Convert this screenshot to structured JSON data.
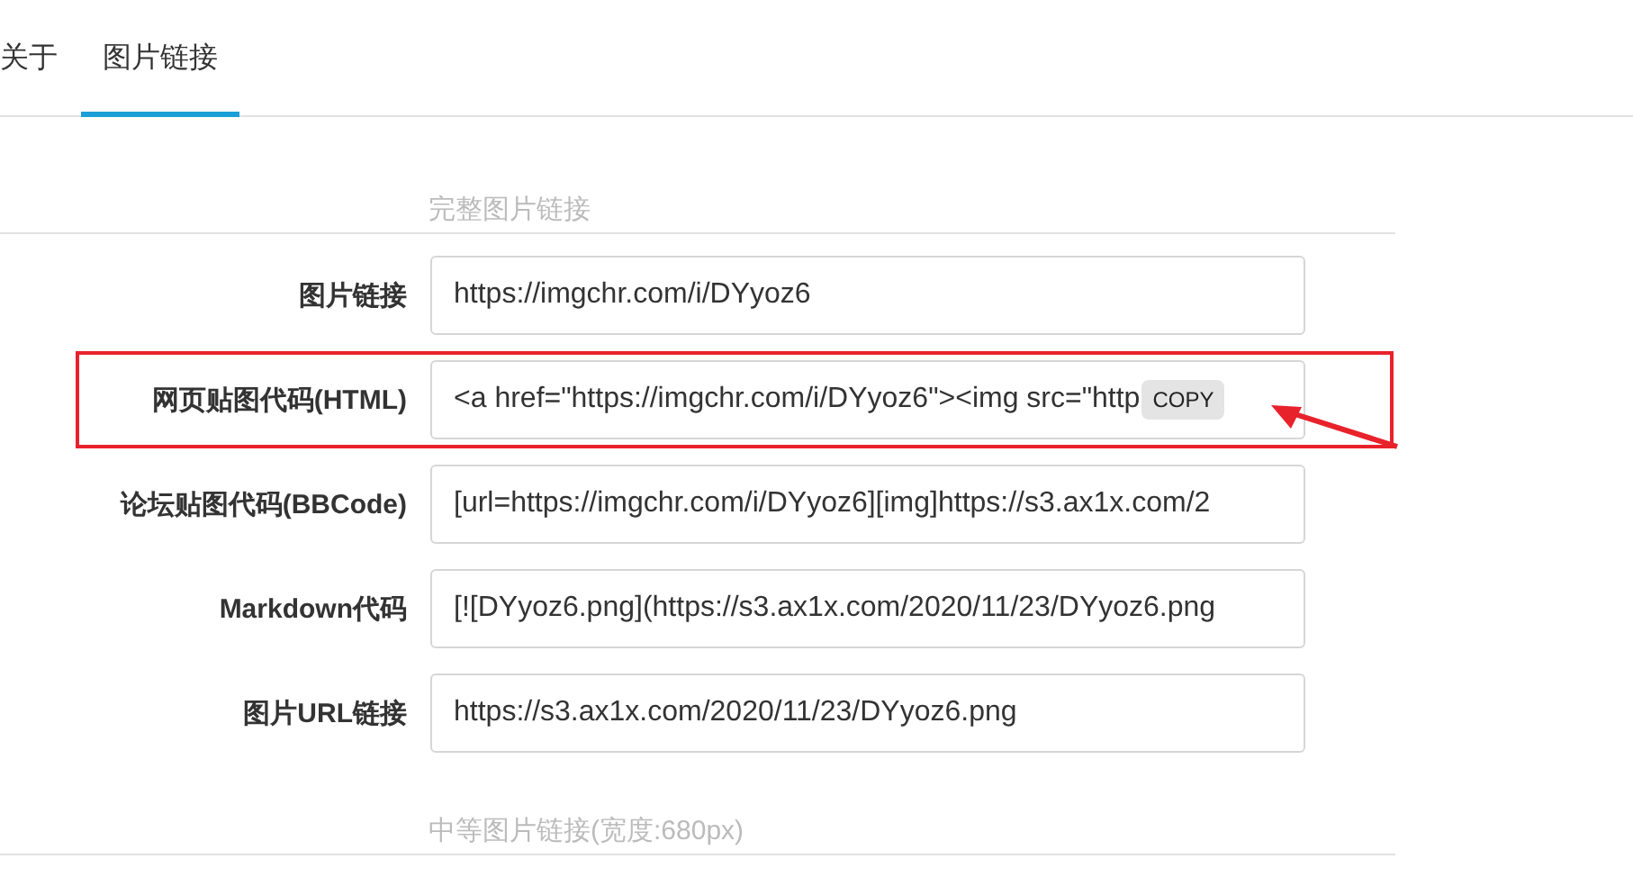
{
  "tabs": [
    {
      "label": "关于",
      "selected": false
    },
    {
      "label": "图片链接",
      "selected": true
    }
  ],
  "sections": [
    {
      "legend": "完整图片链接",
      "rows": [
        {
          "label": "图片链接",
          "value": "https://imgchr.com/i/DYyoz6",
          "highlighted": false
        },
        {
          "label": "网页贴图代码(HTML)",
          "value": "<a href=\"https://imgchr.com/i/DYyoz6\"><img src=\"http",
          "copy_button": "COPY",
          "highlighted": true
        },
        {
          "label": "论坛贴图代码(BBCode)",
          "value": "[url=https://imgchr.com/i/DYyoz6][img]https://s3.ax1x.com/2",
          "highlighted": false
        },
        {
          "label": "Markdown代码",
          "value": "[![DYyoz6.png](https://s3.ax1x.com/2020/11/23/DYyoz6.png",
          "highlighted": false
        },
        {
          "label": "图片URL链接",
          "value": "https://s3.ax1x.com/2020/11/23/DYyoz6.png",
          "highlighted": false
        }
      ]
    },
    {
      "legend": "中等图片链接(宽度:680px)"
    }
  ]
}
